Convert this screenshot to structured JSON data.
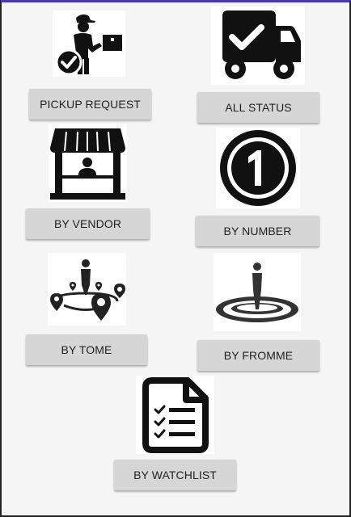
{
  "colors": {
    "icon": "#111111",
    "button_bg": "#d6d6d6",
    "screen_bg": "#f5f5f5",
    "status_bar": "#4a3aa8"
  },
  "items": [
    {
      "label": "PICKUP REQUEST",
      "icon": "delivery-person-icon"
    },
    {
      "label": "ALL STATUS",
      "icon": "delivery-truck-check-icon"
    },
    {
      "label": "BY VENDOR",
      "icon": "vendor-store-icon"
    },
    {
      "label": "BY NUMBER",
      "icon": "number-one-icon"
    },
    {
      "label": "BY TOME",
      "icon": "route-pins-icon"
    },
    {
      "label": "BY FROMME",
      "icon": "location-person-icon"
    },
    {
      "label": "BY WATCHLIST",
      "icon": "checklist-document-icon"
    }
  ]
}
